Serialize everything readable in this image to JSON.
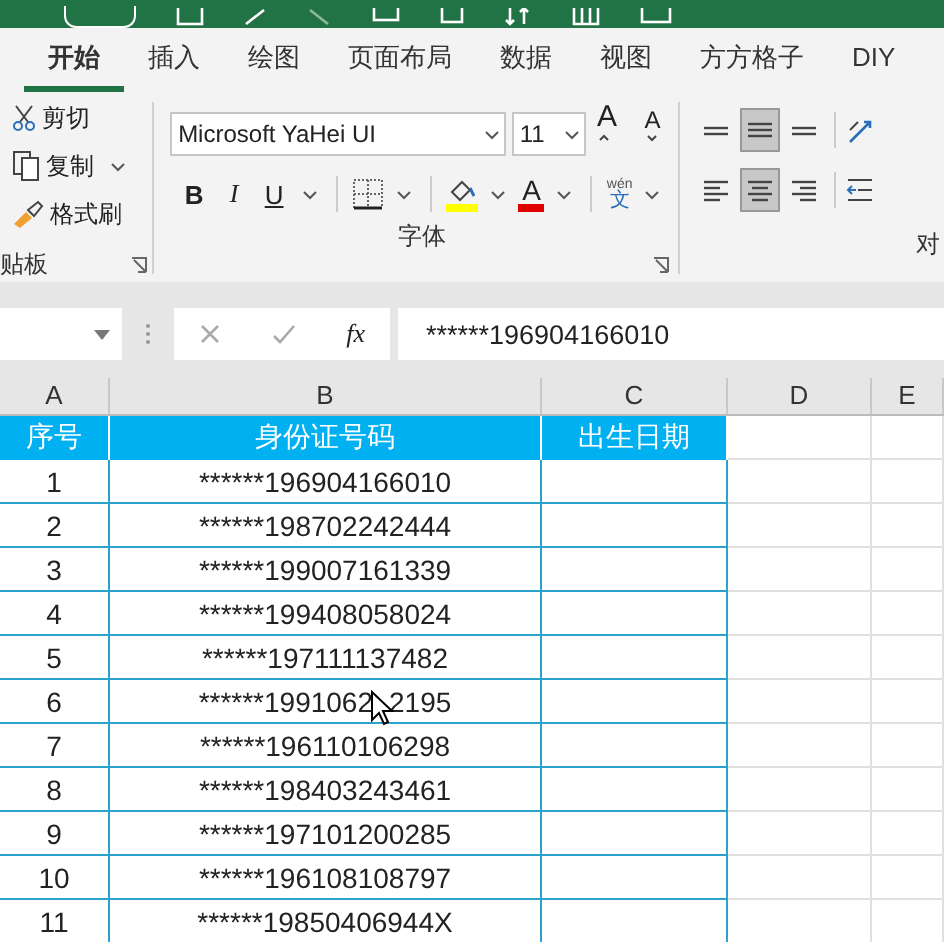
{
  "tabs": [
    {
      "label": "开始",
      "selected": true
    },
    {
      "label": "插入",
      "selected": false
    },
    {
      "label": "绘图",
      "selected": false
    },
    {
      "label": "页面布局",
      "selected": false
    },
    {
      "label": "数据",
      "selected": false
    },
    {
      "label": "视图",
      "selected": false
    },
    {
      "label": "方方格子",
      "selected": false
    },
    {
      "label": "DIY",
      "selected": false
    }
  ],
  "clipboard": {
    "cut": "剪切",
    "copy": "复制",
    "painter": "格式刷",
    "label": "贴板"
  },
  "font": {
    "name": "Microsoft YaHei UI",
    "size": "11",
    "grow": "A",
    "shrink": "A",
    "bold": "B",
    "italic": "I",
    "underline": "U",
    "color_letter": "A",
    "phonetic_top": "wén",
    "phonetic_bottom": "文",
    "label": "字体"
  },
  "align": {
    "rows": [
      [
        {
          "kind": "top",
          "on": false
        },
        {
          "kind": "middle",
          "on": true
        },
        {
          "kind": "bottom",
          "on": false
        }
      ],
      [
        {
          "kind": "left",
          "on": false
        },
        {
          "kind": "center",
          "on": true
        },
        {
          "kind": "right",
          "on": false
        }
      ]
    ],
    "label": "对"
  },
  "formula_bar": {
    "fx": "fx",
    "value": "******196904166010"
  },
  "columns": [
    "A",
    "B",
    "C",
    "D",
    "E"
  ],
  "header": [
    "序号",
    "身份证号码",
    "出生日期"
  ],
  "rows": [
    {
      "no": "1",
      "id": "******196904166010"
    },
    {
      "no": "2",
      "id": "******198702242444"
    },
    {
      "no": "3",
      "id": "******199007161339"
    },
    {
      "no": "4",
      "id": "******199408058024"
    },
    {
      "no": "5",
      "id": "******197111137482"
    },
    {
      "no": "6",
      "id": "******1991062",
      "id_after": "2195"
    },
    {
      "no": "7",
      "id": "******196110106298"
    },
    {
      "no": "8",
      "id": "******198403243461"
    },
    {
      "no": "9",
      "id": "******197101200285"
    },
    {
      "no": "10",
      "id": "******196108108797"
    },
    {
      "no": "11",
      "id": "******19850406944X"
    }
  ]
}
